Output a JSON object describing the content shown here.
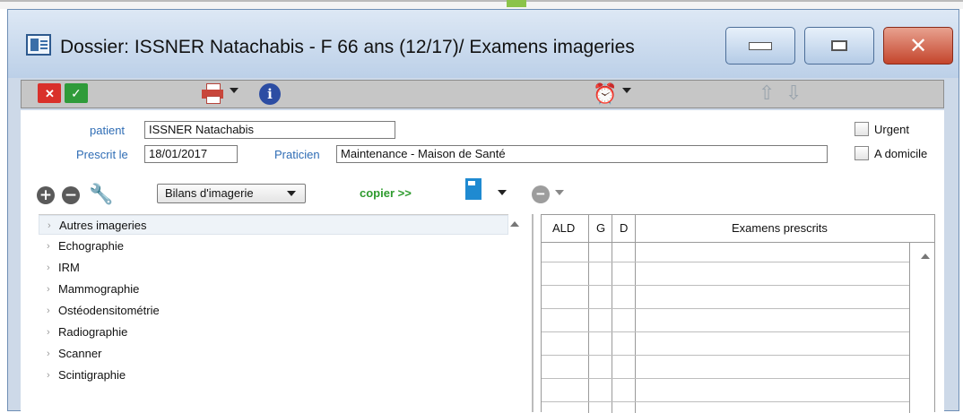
{
  "window": {
    "title": "Dossier: ISSNER Natachabis - F 66 ans (12/17)/ Examens imageries",
    "close_glyph": "✕"
  },
  "toolbar": {
    "cancel_glyph": "✕",
    "validate_glyph": "✓",
    "info_glyph": "i",
    "alarm_glyph": "⏰",
    "up_glyph": "⇧",
    "down_glyph": "⇩"
  },
  "form": {
    "patient_label": "patient",
    "patient_value": "ISSNER Natachabis",
    "prescrit_label": "Prescrit le",
    "prescrit_value": "18/01/2017",
    "praticien_label": "Praticien",
    "praticien_value": "Maintenance - Maison de Santé",
    "urgent_label": "Urgent",
    "domicile_label": "A domicile"
  },
  "actions": {
    "add_glyph": "+",
    "remove_glyph": "−",
    "wrench_glyph": "🔧",
    "bilan_select_value": "Bilans d'imagerie",
    "copier_label": "copier >>",
    "remove2_glyph": "−"
  },
  "tree": {
    "items": [
      "Autres imageries",
      "Echographie",
      "IRM",
      "Mammographie",
      "Ostéodensitométrie",
      "Radiographie",
      "Scanner",
      "Scintigraphie"
    ]
  },
  "grid": {
    "headers": [
      "ALD",
      "G",
      "D",
      "Examens prescrits"
    ]
  },
  "colors": {
    "accent_label": "#2f6db5",
    "copier": "#2e9b2e",
    "close_button": "#c4452c"
  }
}
